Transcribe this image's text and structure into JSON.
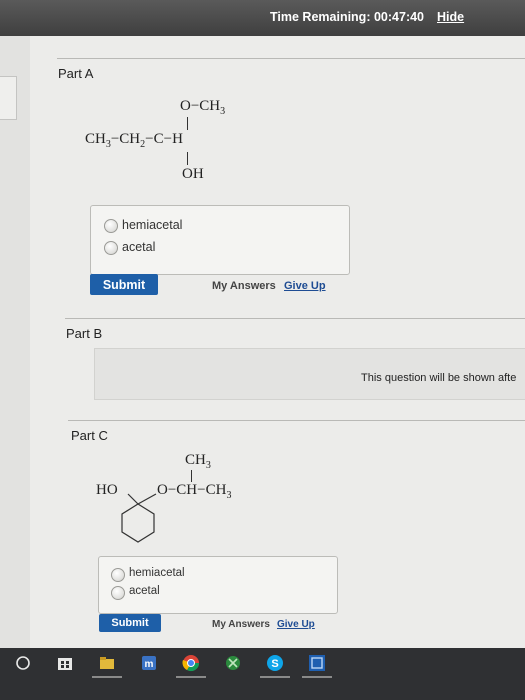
{
  "header": {
    "timer_label": "Time Remaining:",
    "timer_value": "00:47:40",
    "hide_label": "Hide"
  },
  "part_a": {
    "label": "Part A",
    "structure": {
      "top_group": "O−CH3",
      "main_chain": "CH3−CH2−C−H",
      "bottom_group": "OH"
    },
    "options": [
      "hemiacetal",
      "acetal"
    ],
    "submit_label": "Submit",
    "my_answers_label": "My Answers",
    "give_up_label": "Give Up"
  },
  "part_b": {
    "label": "Part B",
    "message": "This question will be shown afte"
  },
  "part_c": {
    "label": "Part C",
    "structure": {
      "top_group": "CH3",
      "ring_substituent": "HO",
      "side_chain": "O−CH−CH3"
    },
    "options": [
      "hemiacetal",
      "acetal"
    ],
    "submit_label": "Submit",
    "my_answers_label": "My Answers",
    "give_up_label": "Give Up"
  },
  "taskbar": {
    "icons": [
      "search-icon",
      "windows-store-icon",
      "file-explorer-icon",
      "app-icon",
      "chrome-icon",
      "xbox-icon",
      "skype-icon",
      "lens-icon"
    ],
    "colors": {
      "accent": "#1e5fa8",
      "taskbar": "#2f3033"
    }
  }
}
